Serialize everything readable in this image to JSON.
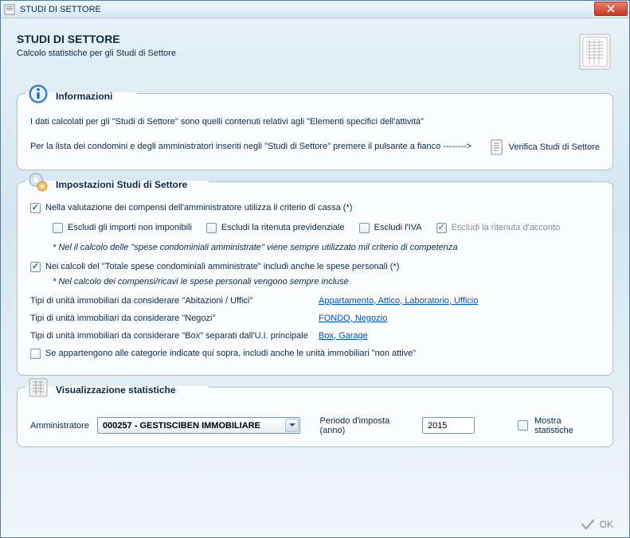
{
  "window": {
    "title": "STUDI DI SETTORE"
  },
  "header": {
    "title": "STUDI DI SETTORE",
    "subtitle": "Calcolo statistiche per gli Studi di Settore"
  },
  "info": {
    "title": "Informazioni",
    "text1": "I dati calcolati per gli \"Studi di Settore\" sono quelli contenuti relativi agli \"Elementi specifici dell'attività\"",
    "text2": "Per la  lista dei condomini e degli amministratori inseriti negli \"Studi di Settore\" premere il pulsante a fianco -------->",
    "verify_label": "Verifica Studi di Settore"
  },
  "settings": {
    "title": "Impostazioni Studi di Settore",
    "cb_cassa": "Nella valutazione dei compensi dell'amministratore utilizza il criterio di cassa (*)",
    "cb_escludi_imponibili": "Escludi gli importi non imponibili",
    "cb_escludi_previdenziale": "Escludi la ritenuta previdenziale",
    "cb_escludi_iva": "Escludi l'IVA",
    "cb_escludi_acconto": "Escludi la ritenuta d'acconto",
    "note1": "* Nel il calcolo delle \"spese condominiali amministrate\" viene sempre utilizzato mil criterio di competenza",
    "cb_personali": "Nei calcoli del \"Totale spese condominiali amministrate\" includi anche le spese personali (*)",
    "note2": "* Nel calcolo dei compensi/ricavi le spese personali vengono sempre incluse",
    "type_abitazioni_label": "Tipi di unità immobiliari da considerare \"Abitazioni / Uffici\"",
    "type_abitazioni_value": "Appartamento, Attico, Laboratorio, Ufficio",
    "type_negozi_label": "Tipi di unità immobiliari da considerare \"Negozi\"",
    "type_negozi_value": "FONDO, Negozio",
    "type_box_label": "Tipi di unità immobiliari da considerare \"Box\" separati dall'U.I. principale",
    "type_box_value": "Box, Garage",
    "cb_nonattive": "Se appartengono alle categorie indicate qui sopra, includi anche le unità immobiliari \"non attive\""
  },
  "stats": {
    "title": "Visualizzazione statistiche",
    "admin_label": "Amministratore",
    "admin_value": "000257 - GESTISCIBEN IMMOBILIARE",
    "period_label": "Periodo d'imposta (anno)",
    "period_value": "2015",
    "show_label": "Mostra statistiche"
  },
  "footer": {
    "ok": "OK"
  }
}
